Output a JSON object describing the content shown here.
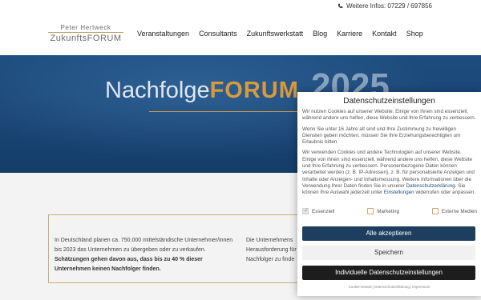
{
  "topbar": {
    "phone_label": "Weitere Infos: 07229 / 697856",
    "phone_icon": "phone-icon"
  },
  "logo": {
    "line1": "Peter Hertweck",
    "line2": "ZukunftsFORUM"
  },
  "nav": [
    {
      "label": "Veranstaltungen"
    },
    {
      "label": "Consultants"
    },
    {
      "label": "Zukunftswerkstatt"
    },
    {
      "label": "Blog"
    },
    {
      "label": "Karriere"
    },
    {
      "label": "Kontakt"
    },
    {
      "label": "Shop"
    }
  ],
  "hero": {
    "title_part1": "Nachfolge",
    "title_part2": "FORUM",
    "year": "2025"
  },
  "content": {
    "para1_normal": "In Deutschland planen ca. 750.000 mittelständische Unternehmer/innen bis 2023 das Unternehmen zu übergeben oder zu verkaufen.",
    "para1_bold": "Schätzungen gehen davon aus, dass bis zu 40 % dieser Unternehmen keinen Nachfolger finden.",
    "para2_line1": "Die Unternehmens",
    "para2_line2": "Herausforderung für",
    "para2_line3": "Nachfolger zu finde"
  },
  "cookie": {
    "title": "Datenschutzeinstellungen",
    "p1": "Wir nutzen Cookies auf unserer Website. Einige von ihnen sind essenziell, während andere uns helfen, diese Website und Ihre Erfahrung zu verbessern.",
    "p2": "Wenn Sie unter 16 Jahre alt sind und Ihre Zustimmung zu freiwilligen Diensten geben möchten, müssen Sie Ihre Erziehungsberechtigten um Erlaubnis bitten.",
    "p3a": "Wir verwenden Cookies und andere Technologien auf unserer Website. Einige von ihnen sind essenziell, während andere uns helfen, diese Website und Ihre Erfahrung zu verbessern. Personenbezogene Daten können verarbeitet werden (z. B. IP-Adressen), z. B. für personalisierte Anzeigen und Inhalte oder Anzeigen- und Inhaltsmessung. Weitere Informationen über die Verwendung Ihrer Daten finden Sie in unserer",
    "link_privacy": "Datenschutzerklärung",
    "p3b": ". Sie können Ihre Auswahl jederzeit unter",
    "link_settings": "Einstellungen",
    "p3c": "widerrufen oder anpassen.",
    "checkboxes": [
      {
        "label": "Essenziell",
        "checked": true
      },
      {
        "label": "Marketing",
        "checked": false
      },
      {
        "label": "Externe Medien",
        "checked": false
      }
    ],
    "btn_accept": "Alle akzeptieren",
    "btn_save": "Speichern",
    "btn_individual": "Individuelle Datenschutzeinstellungen",
    "footer_links": [
      "Cookie-Details",
      "Datenschutzerklärung",
      "Impressum"
    ]
  }
}
